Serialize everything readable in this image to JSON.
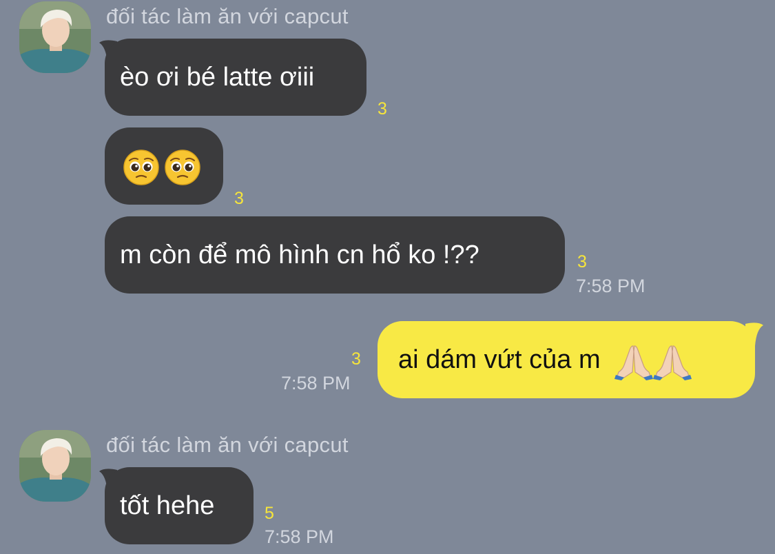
{
  "chat": {
    "sender_name": "đối tác làm ăn với capcut",
    "messages": [
      {
        "direction": "incoming",
        "text": "èo ơi bé latte ơiii",
        "unread": "3",
        "time": ""
      },
      {
        "direction": "incoming",
        "emoji": [
          "pleading-face",
          "pleading-face"
        ],
        "unread": "3",
        "time": ""
      },
      {
        "direction": "incoming",
        "text": "m còn để mô hình cn hổ ko !??",
        "unread": "3",
        "time": "7:58 PM"
      },
      {
        "direction": "outgoing",
        "text": "ai dám vứt của m",
        "emoji": [
          "folded-hands",
          "folded-hands"
        ],
        "unread": "3",
        "time": "7:58 PM"
      },
      {
        "direction": "incoming",
        "text": "tốt hehe",
        "unread": "5",
        "time": "7:58 PM"
      }
    ]
  },
  "colors": {
    "background": "#7f8898",
    "incoming_bubble": "#3b3b3d",
    "outgoing_bubble": "#f8e945",
    "unread_count": "#f6e53b",
    "meta_text": "#d2d6de"
  }
}
